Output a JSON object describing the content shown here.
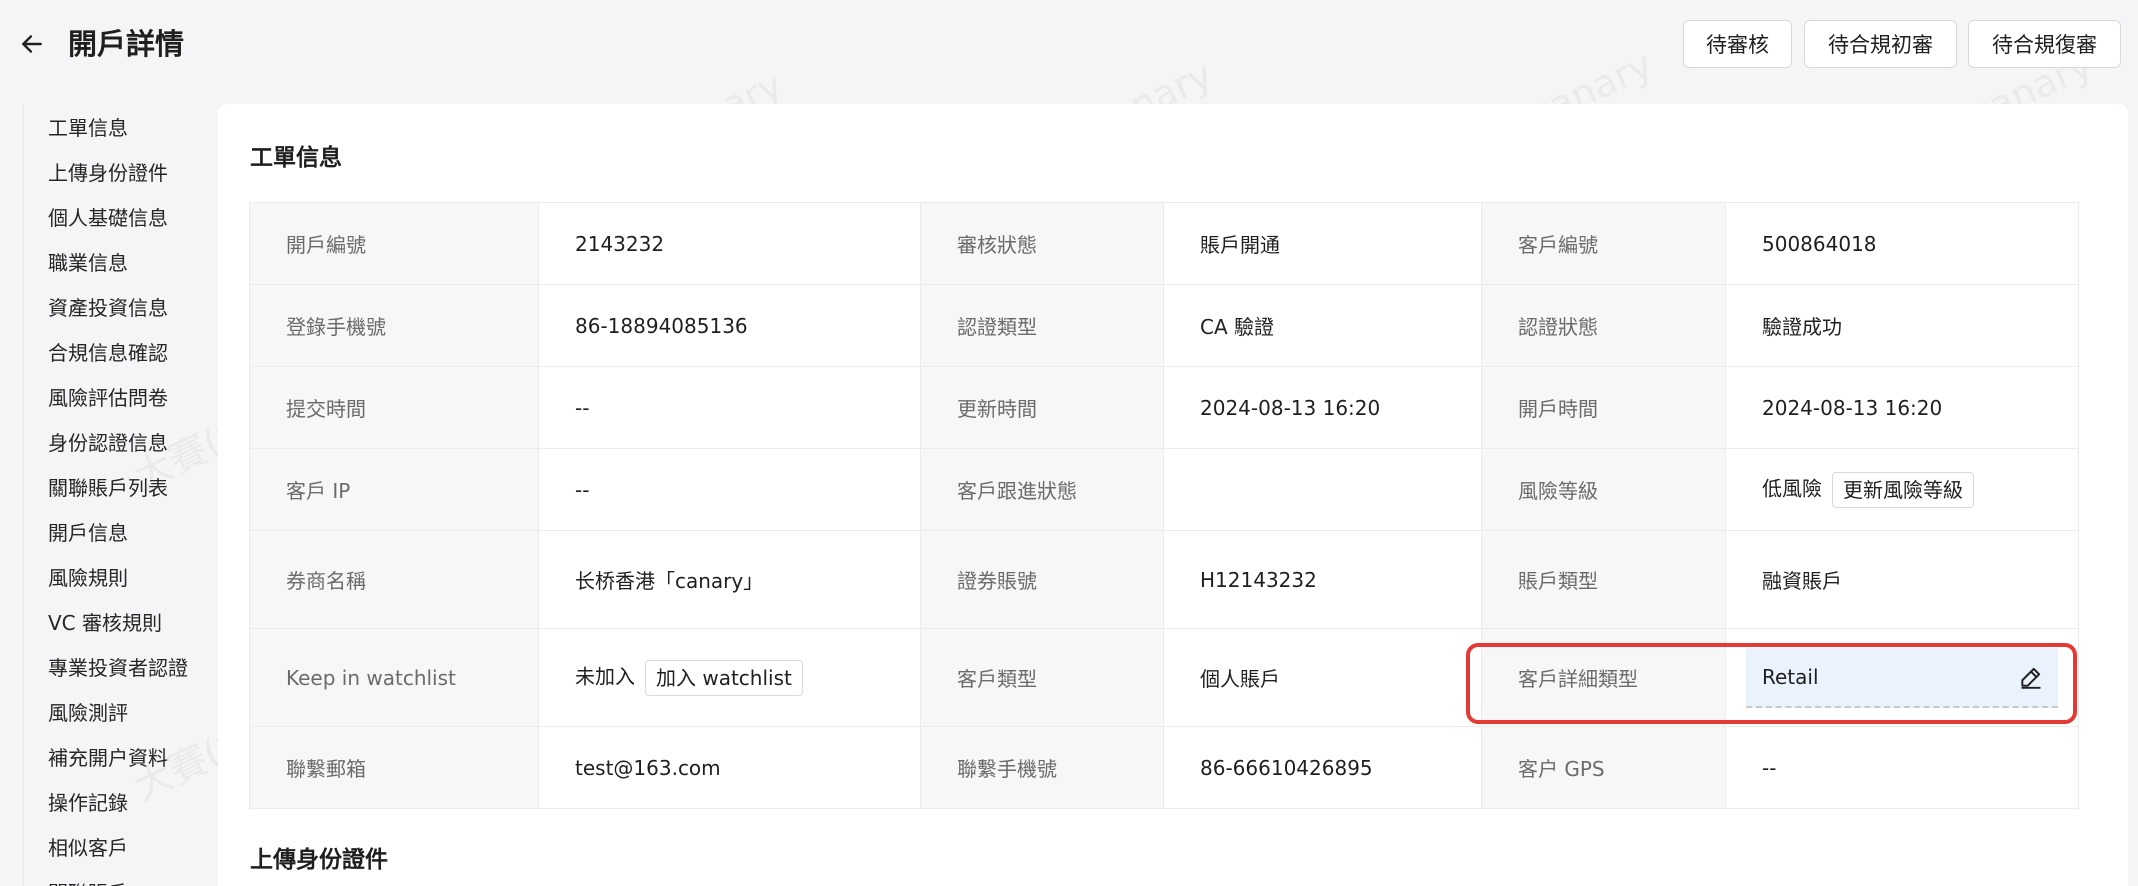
{
  "header": {
    "title": "開戶詳情",
    "buttons": [
      "待審核",
      "待合規初審",
      "待合規復審"
    ]
  },
  "sidebar": {
    "items": [
      "工單信息",
      "上傳身份證件",
      "個人基礎信息",
      "職業信息",
      "資產投資信息",
      "合規信息確認",
      "風險評估問卷",
      "身份認證信息",
      "關聯賬戶列表",
      "開戶信息",
      "風險規則",
      "VC 審核規則",
      "專業投資者認證",
      "風險測評",
      "補充開户資料",
      "操作記錄",
      "相似客戶",
      "關聯賬戶"
    ]
  },
  "watermark": "大賽(桂賽) canary",
  "section1": {
    "title": "工單信息",
    "rows": [
      [
        {
          "l": "開戶編號",
          "v": "2143232"
        },
        {
          "l": "審核狀態",
          "v": "賬戶開通"
        },
        {
          "l": "客戶編號",
          "v": "500864018"
        }
      ],
      [
        {
          "l": "登錄手機號",
          "v": "86-18894085136"
        },
        {
          "l": "認證類型",
          "v": "CA 驗證"
        },
        {
          "l": "認證狀態",
          "v": "驗證成功"
        }
      ],
      [
        {
          "l": "提交時間",
          "v": "--"
        },
        {
          "l": "更新時間",
          "v": "2024-08-13 16:20"
        },
        {
          "l": "開戶時間",
          "v": "2024-08-13 16:20"
        }
      ],
      [
        {
          "l": "客戶 IP",
          "v": "--"
        },
        {
          "l": "客戶跟進狀態",
          "v": ""
        },
        {
          "l": "風險等級",
          "v": "低風險",
          "btn": "更新風險等級"
        }
      ],
      [
        {
          "l": "券商名稱",
          "v": "长桥香港「canary」"
        },
        {
          "l": "證券賬號",
          "v": "H12143232"
        },
        {
          "l": "賬戶類型",
          "v": "融資賬戶"
        }
      ],
      [
        {
          "l": "Keep in watchlist",
          "v": "未加入",
          "btn": "加入 watchlist"
        },
        {
          "l": "客戶類型",
          "v": "個人賬戶"
        },
        {
          "l": "客戶詳細類型",
          "v": "Retail",
          "editable": true
        }
      ],
      [
        {
          "l": "聯繫郵箱",
          "v": "test@163.com"
        },
        {
          "l": "聯繫手機號",
          "v": "86-66610426895"
        },
        {
          "l": "客户 GPS",
          "v": "--"
        }
      ]
    ]
  },
  "section2": {
    "title": "上傳身份證件"
  },
  "icons": {
    "back": "arrow-left-icon",
    "edit": "pencil-icon"
  },
  "colors": {
    "highlight": "#e53935",
    "editable_bg": "#eaf3fd"
  }
}
